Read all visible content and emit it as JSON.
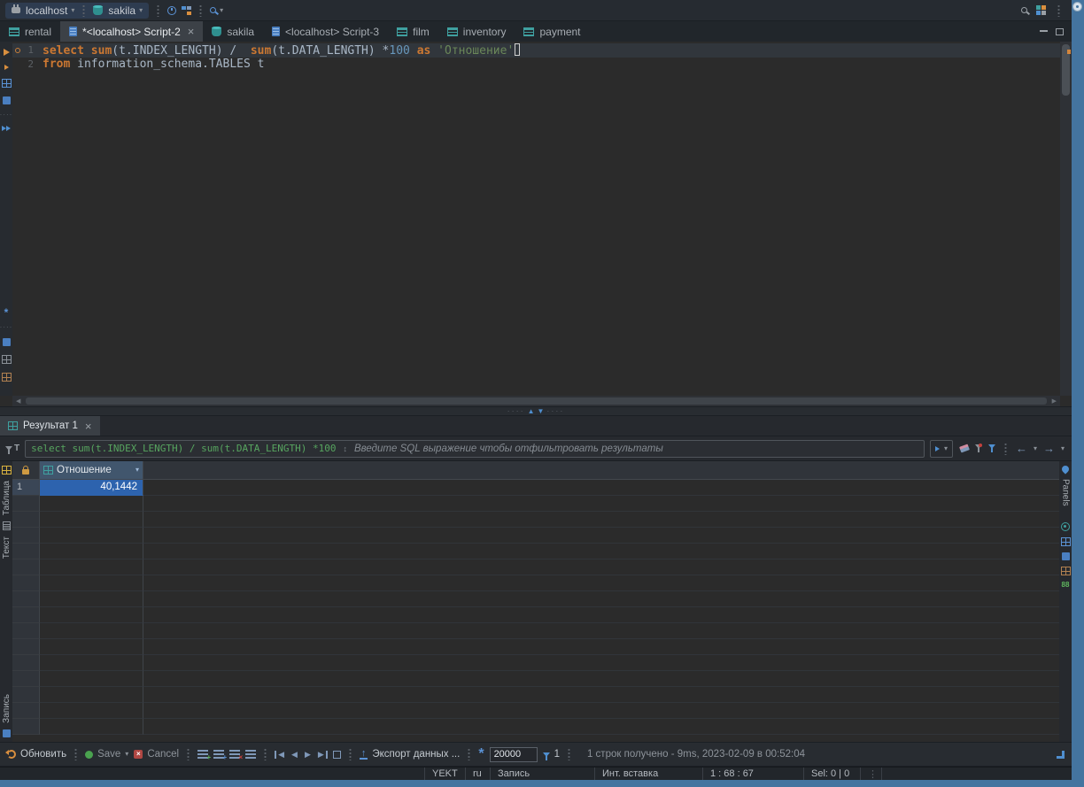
{
  "colors": {
    "desktop": "#44749f",
    "selection_cell": "#2d63ae",
    "keyword": "#cc7832",
    "string": "#6a8759",
    "number": "#6897bb",
    "filter_green": "#57a55f"
  },
  "icons": {
    "connection-icon": "plug shape",
    "database-icon": "teal cylinder",
    "search-icon": "magnifier",
    "lock-icon": "orange padlock",
    "filter-icon": "funnel",
    "refresh-icon": "orange circular arrow",
    "save-icon": "green dot",
    "cancel-icon": "red square with x",
    "export-icon": "blue up arrow over tray"
  },
  "topbar": {
    "connection": "localhost",
    "database": "sakila"
  },
  "tabs": [
    {
      "label": "rental",
      "icon": "table-icon",
      "active": false,
      "closable": false
    },
    {
      "label": "*<localhost> Script-2",
      "icon": "sql-file-icon",
      "active": true,
      "closable": true
    },
    {
      "label": "sakila",
      "icon": "database-icon",
      "active": false,
      "closable": false
    },
    {
      "label": "<localhost> Script-3",
      "icon": "sql-file-icon",
      "active": false,
      "closable": false
    },
    {
      "label": "film",
      "icon": "table-icon",
      "active": false,
      "closable": false
    },
    {
      "label": "inventory",
      "icon": "table-icon",
      "active": false,
      "closable": false
    },
    {
      "label": "payment",
      "icon": "table-icon",
      "active": false,
      "closable": false
    }
  ],
  "editor": {
    "lines": [
      {
        "num": "1",
        "current": true,
        "marker": true,
        "tokens": [
          {
            "t": "select ",
            "c": "kw"
          },
          {
            "t": "sum",
            "c": "kw"
          },
          {
            "t": "(",
            "c": "pl"
          },
          {
            "t": "t.INDEX_LENGTH",
            "c": "id"
          },
          {
            "t": ") ",
            "c": "pl"
          },
          {
            "t": "/  ",
            "c": "pl"
          },
          {
            "t": "sum",
            "c": "kw"
          },
          {
            "t": "(",
            "c": "pl"
          },
          {
            "t": "t.DATA_LENGTH",
            "c": "id"
          },
          {
            "t": ") *",
            "c": "pl"
          },
          {
            "t": "100",
            "c": "num"
          },
          {
            "t": " ",
            "c": "pl"
          },
          {
            "t": "as",
            "c": "kw"
          },
          {
            "t": " ",
            "c": "pl"
          },
          {
            "t": "'Отношение'",
            "c": "str"
          },
          {
            "t": "",
            "c": "cursor"
          }
        ]
      },
      {
        "num": "2",
        "current": false,
        "marker": false,
        "tokens": [
          {
            "t": "from",
            "c": "kw"
          },
          {
            "t": " information_schema.TABLES t",
            "c": "id"
          }
        ]
      }
    ]
  },
  "results": {
    "tab_label": "Результат 1",
    "filter": {
      "active_expression": "select sum(t.INDEX_LENGTH) / sum(t.DATA_LENGTH) *100",
      "placeholder": "Введите SQL выражение чтобы отфильтровать результаты"
    },
    "side_tabs": [
      "Таблица",
      "Текст",
      "Запись"
    ],
    "panels_label": "Panels",
    "grid": {
      "columns": [
        {
          "name": "Отношение"
        }
      ],
      "rows": [
        {
          "num": "1",
          "values": [
            "40,1442"
          ]
        }
      ],
      "empty_row_count": 15
    },
    "toolbar": {
      "refresh": "Обновить",
      "save": "Save",
      "cancel": "Cancel",
      "export": "Экспорт данных ...",
      "fetch_size": "20000",
      "filter_count": "1",
      "status": "1 строк получено - 9ms, 2023-02-09 в 00:52:04"
    }
  },
  "statusbar": {
    "timezone": "YEKT",
    "language": "ru",
    "write_mode": "Запись",
    "insert_mode": "Инт. вставка",
    "caret_position": "1 : 68 : 67",
    "selection": "Sel: 0 | 0"
  }
}
